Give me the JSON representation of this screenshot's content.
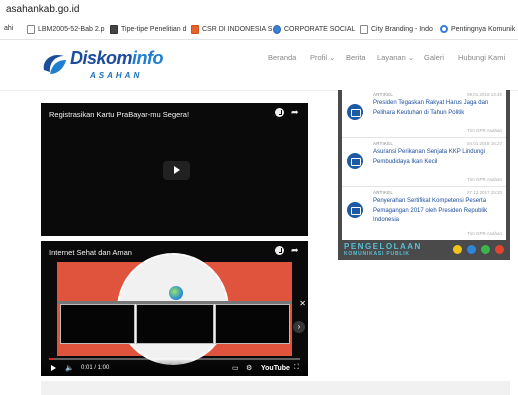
{
  "browser": {
    "url": "asahankab.go.id",
    "bookmarks": [
      {
        "label": "ahi",
        "icon": "page-icon"
      },
      {
        "label": "LBM2005-52-Bab 2.p",
        "icon": "page-icon"
      },
      {
        "label": "Tipe-tipe Penelitian d",
        "icon": "image-icon"
      },
      {
        "label": "CSR DI INDONESIA S",
        "icon": "blogger-icon"
      },
      {
        "label": "CORPORATE SOCIAL",
        "icon": "circle-logo-icon"
      },
      {
        "label": "City Branding - Indo",
        "icon": "page-icon"
      },
      {
        "label": "Pentingnya Komunik",
        "icon": "globe-icon"
      }
    ]
  },
  "site": {
    "logo_main": "Diskom",
    "logo_accent": "info",
    "logo_sub": "ASAHAN",
    "nav": [
      {
        "label": "Beranda"
      },
      {
        "label": "Profil ⌄"
      },
      {
        "label": "Berita"
      },
      {
        "label": "Layanan ⌄"
      },
      {
        "label": "Galeri"
      },
      {
        "label": "Hubungi Kami"
      }
    ]
  },
  "videos": [
    {
      "title": "Registrasikan Kartu PraBayar-mu Segera!"
    },
    {
      "title": "Internet Sehat dan Aman",
      "time": "0:01 / 1:00",
      "progress": 0.02,
      "brand": "YouTube"
    }
  ],
  "articles": [
    {
      "category": "ARTIKEL",
      "date": "09.01.2018 13:46",
      "title": "Presiden Tegaskan Rakyat Harus Jaga dan Pelihara Keutuhan di Tahun Politik",
      "by": "Tim GPR Asahan"
    },
    {
      "category": "ARTIKEL",
      "date": "04.01.2018 15:27",
      "title": "Asuransi Perikanan Senjata KKP Lindungi Pembudidaya Ikan Kecil",
      "by": "Tim GPR Asahan"
    },
    {
      "category": "ARTIKEL",
      "date": "27.12.2017 15:20",
      "title": "Penyerahan Sertifikat Kompetensi Peserta Pemagangan 2017 oleh Presiden Republik Indonesia",
      "by": "Tim GPR Asahan"
    }
  ],
  "banner": {
    "line1": "PENGELOLAAN",
    "line2": "KOMUNIKASI PUBLIK"
  },
  "colors": {
    "brand_blue": "#1b4d9b",
    "video_red": "#e0543e",
    "sidebar_dark": "#4a4a4a",
    "banner_cyan": "#57c0d8"
  }
}
